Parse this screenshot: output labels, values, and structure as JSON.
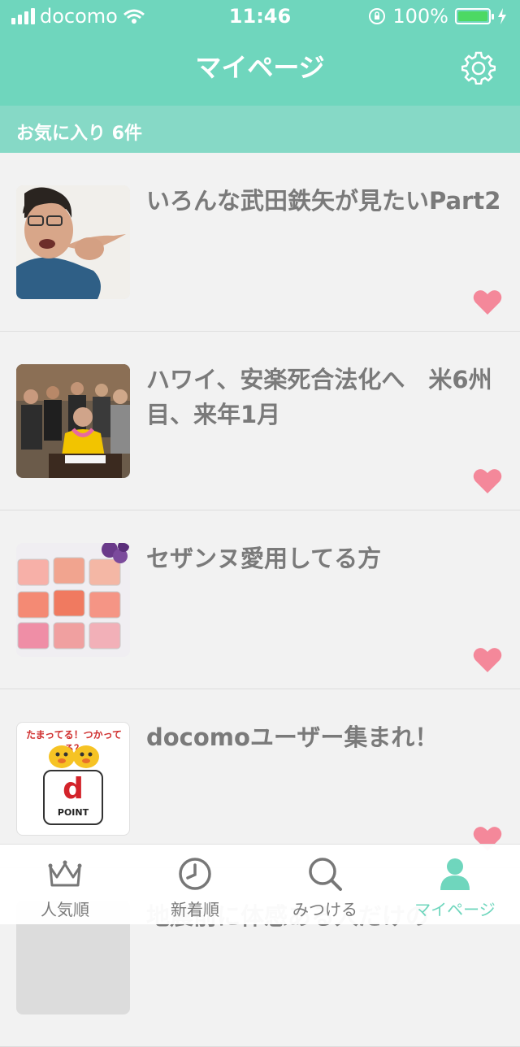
{
  "status_bar": {
    "carrier": "docomo",
    "time": "11:46",
    "battery": "100%"
  },
  "header": {
    "title": "マイページ",
    "settings_icon": "gear-icon"
  },
  "subheader": {
    "label": "お気に入り 6件"
  },
  "list": {
    "items": [
      {
        "title": "いろんな武田鉄矢が見たいPart2"
      },
      {
        "title": "ハワイ、安楽死合法化へ　米6州目、来年1月"
      },
      {
        "title": "セザンヌ愛用してる方"
      },
      {
        "title": "docomoユーザー集まれ！"
      },
      {
        "title": "地震前に体感ある人だけの"
      }
    ],
    "thumb4_caption": "たまってる！つかってる？",
    "thumb4_letter": "d",
    "thumb4_brand": "POINT"
  },
  "tabbar": {
    "items": [
      {
        "label": "人気順",
        "icon": "crown-icon"
      },
      {
        "label": "新着順",
        "icon": "clock-icon"
      },
      {
        "label": "みつける",
        "icon": "search-icon"
      },
      {
        "label": "マイページ",
        "icon": "user-icon"
      }
    ]
  },
  "colors": {
    "accent": "#6fd6bd",
    "heart": "#f4889a",
    "title_text": "#7a7a7a"
  }
}
